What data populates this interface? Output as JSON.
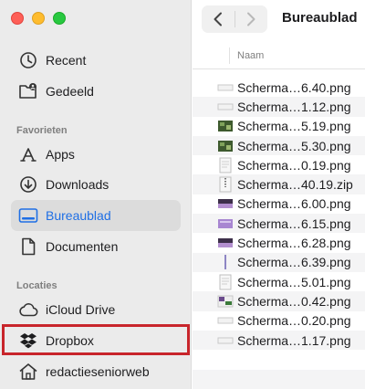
{
  "window": {
    "title": "Bureaublad",
    "column_header": "Naam"
  },
  "sidebar": {
    "top_items": [
      {
        "label": "Recent",
        "icon": "clock-icon"
      },
      {
        "label": "Gedeeld",
        "icon": "shared-folder-icon"
      }
    ],
    "favorites_heading": "Favorieten",
    "favorites": [
      {
        "label": "Apps",
        "icon": "apps-icon"
      },
      {
        "label": "Downloads",
        "icon": "download-icon"
      },
      {
        "label": "Bureaublad",
        "icon": "desktop-icon",
        "active": true
      },
      {
        "label": "Documenten",
        "icon": "document-icon"
      }
    ],
    "locations_heading": "Locaties",
    "locations": [
      {
        "label": "iCloud Drive",
        "icon": "cloud-icon"
      },
      {
        "label": "Dropbox",
        "icon": "dropbox-icon",
        "highlighted": true
      },
      {
        "label": "redactieseniorweb",
        "icon": "home-icon"
      }
    ]
  },
  "files": [
    {
      "name": "Scherma…6.40.png",
      "thumb": "blank"
    },
    {
      "name": "Scherma…1.12.png",
      "thumb": "blank"
    },
    {
      "name": "Scherma…5.19.png",
      "thumb": "image-green"
    },
    {
      "name": "Scherma…5.30.png",
      "thumb": "image-green"
    },
    {
      "name": "Scherma…0.19.png",
      "thumb": "page"
    },
    {
      "name": "Scherma…40.19.zip",
      "thumb": "zip"
    },
    {
      "name": "Scherma…6.00.png",
      "thumb": "image-dark"
    },
    {
      "name": "Scherma…6.15.png",
      "thumb": "image-purple"
    },
    {
      "name": "Scherma…6.28.png",
      "thumb": "image-dark"
    },
    {
      "name": "Scherma…6.39.png",
      "thumb": "line"
    },
    {
      "name": "Scherma…5.01.png",
      "thumb": "page"
    },
    {
      "name": "Scherma…0.42.png",
      "thumb": "image-mixed"
    },
    {
      "name": "Scherma…0.20.png",
      "thumb": "blank"
    },
    {
      "name": "Scherma…1.17.png",
      "thumb": "blank"
    }
  ],
  "colors": {
    "accent": "#1f6fe5",
    "highlight_border": "#c8252b",
    "sidebar_bg": "#ebebeb"
  }
}
